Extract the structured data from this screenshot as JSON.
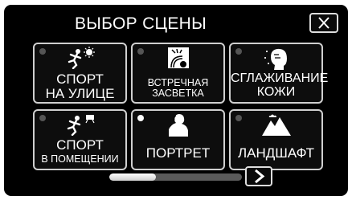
{
  "header": {
    "title": "ВЫБОР СЦЕНЫ",
    "close_icon": "close-icon"
  },
  "tiles": [
    {
      "line1": "СПОРТ",
      "line2": "НА УЛИЦЕ",
      "icon": "sport-outdoor-icon",
      "selected": false
    },
    {
      "line1": "ВСТРЕЧНАЯ ЗАСВЕТКА",
      "line2": "",
      "icon": "backlight-icon",
      "selected": false
    },
    {
      "line1": "СГЛАЖИВАНИЕ",
      "line2": "КОЖИ",
      "icon": "skin-smoothing-icon",
      "selected": false
    },
    {
      "line1": "СПОРТ",
      "line2": "В ПОМЕЩЕНИИ",
      "icon": "sport-indoor-icon",
      "selected": false
    },
    {
      "line1": "ПОРТРЕТ",
      "line2": "",
      "icon": "portrait-icon",
      "selected": true
    },
    {
      "line1": "ЛАНДШАФТ",
      "line2": "",
      "icon": "landscape-icon",
      "selected": false
    }
  ],
  "pager": {
    "scroll_position": 0.35,
    "next_icon": "chevron-right-icon"
  },
  "colors": {
    "background": "#000000",
    "border": "#cfcfcf",
    "text": "#ffffff",
    "indicator_off": "#555555",
    "indicator_on": "#ffffff"
  }
}
